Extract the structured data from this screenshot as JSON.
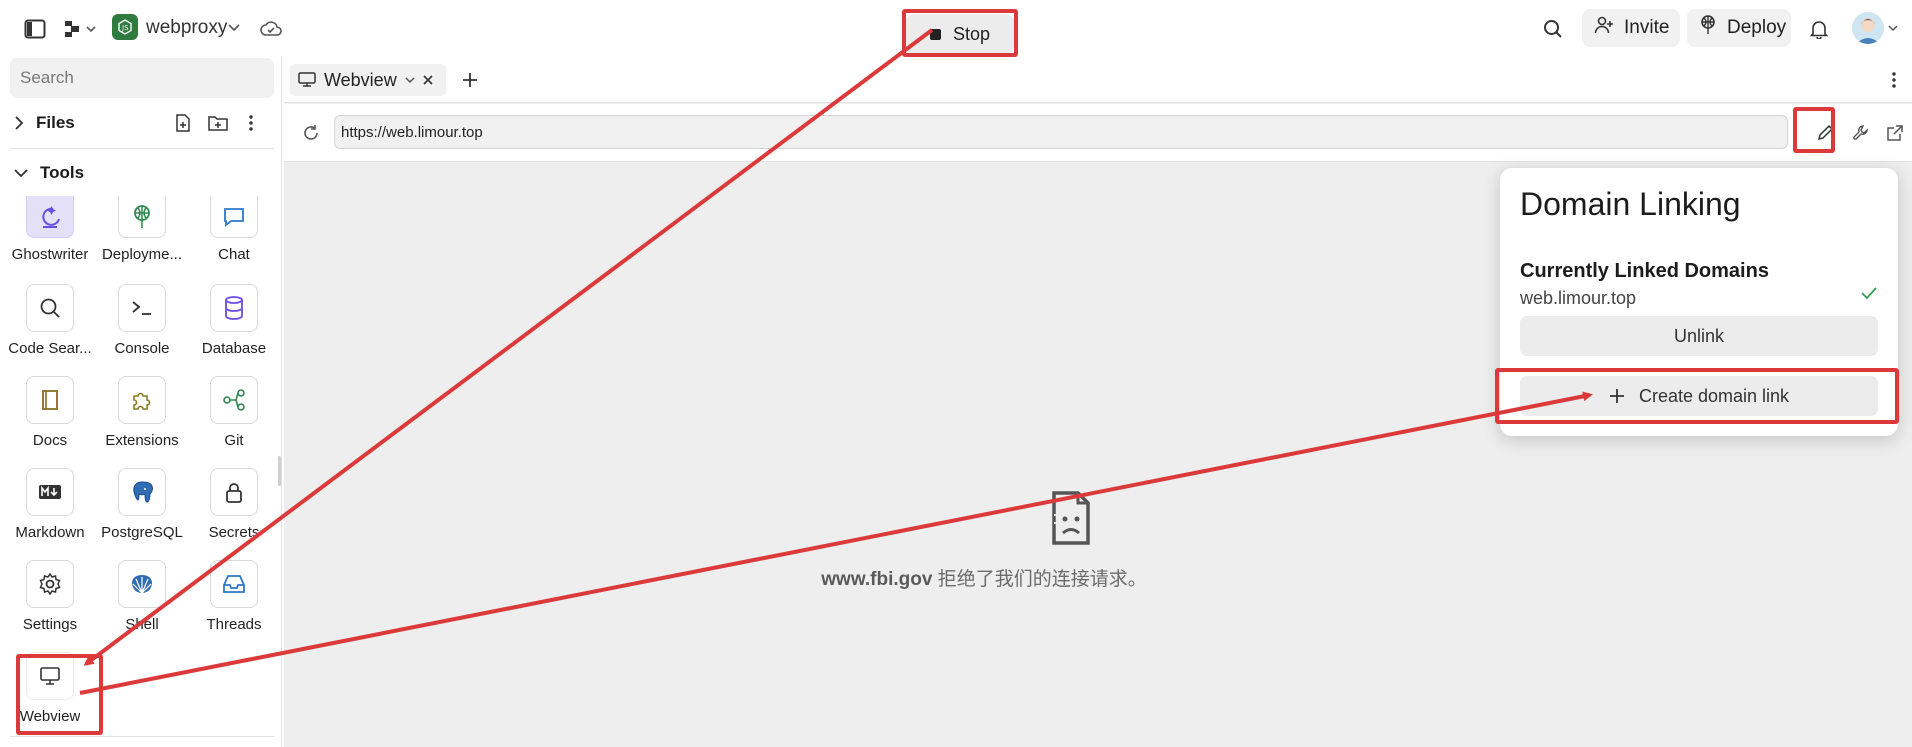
{
  "topbar": {
    "project_name": "webproxy",
    "stop_label": "Stop",
    "invite_label": "Invite",
    "deploy_label": "Deploy"
  },
  "sidebar": {
    "search_placeholder": "Search",
    "files_label": "Files",
    "tools_label": "Tools",
    "tools": [
      {
        "label": "Ghostwriter",
        "icon": "ghostwriter-icon"
      },
      {
        "label": "Deployme...",
        "icon": "deployments-icon"
      },
      {
        "label": "Chat",
        "icon": "chat-icon"
      },
      {
        "label": "Code Sear...",
        "icon": "search-icon"
      },
      {
        "label": "Console",
        "icon": "console-icon"
      },
      {
        "label": "Database",
        "icon": "database-icon"
      },
      {
        "label": "Docs",
        "icon": "book-icon"
      },
      {
        "label": "Extensions",
        "icon": "puzzle-icon"
      },
      {
        "label": "Git",
        "icon": "git-icon"
      },
      {
        "label": "Markdown",
        "icon": "markdown-icon"
      },
      {
        "label": "PostgreSQL",
        "icon": "elephant-icon"
      },
      {
        "label": "Secrets",
        "icon": "lock-icon"
      },
      {
        "label": "Settings",
        "icon": "gear-icon"
      },
      {
        "label": "Shell",
        "icon": "shell-icon"
      },
      {
        "label": "Threads",
        "icon": "inbox-icon"
      },
      {
        "label": "Webview",
        "icon": "monitor-icon"
      }
    ]
  },
  "main": {
    "tab_label": "Webview",
    "url_value": "https://web.limour.top",
    "error_host": "www.fbi.gov",
    "error_message": " 拒绝了我们的连接请求。"
  },
  "popover": {
    "title": "Domain Linking",
    "subtitle": "Currently Linked Domains",
    "domain": "web.limour.top",
    "unlink_label": "Unlink",
    "create_label": "Create domain link"
  },
  "colors": {
    "annotation_red": "#dc3a3a",
    "accent_purple": "#7a5cf0",
    "check_green": "#2e9e4f"
  }
}
